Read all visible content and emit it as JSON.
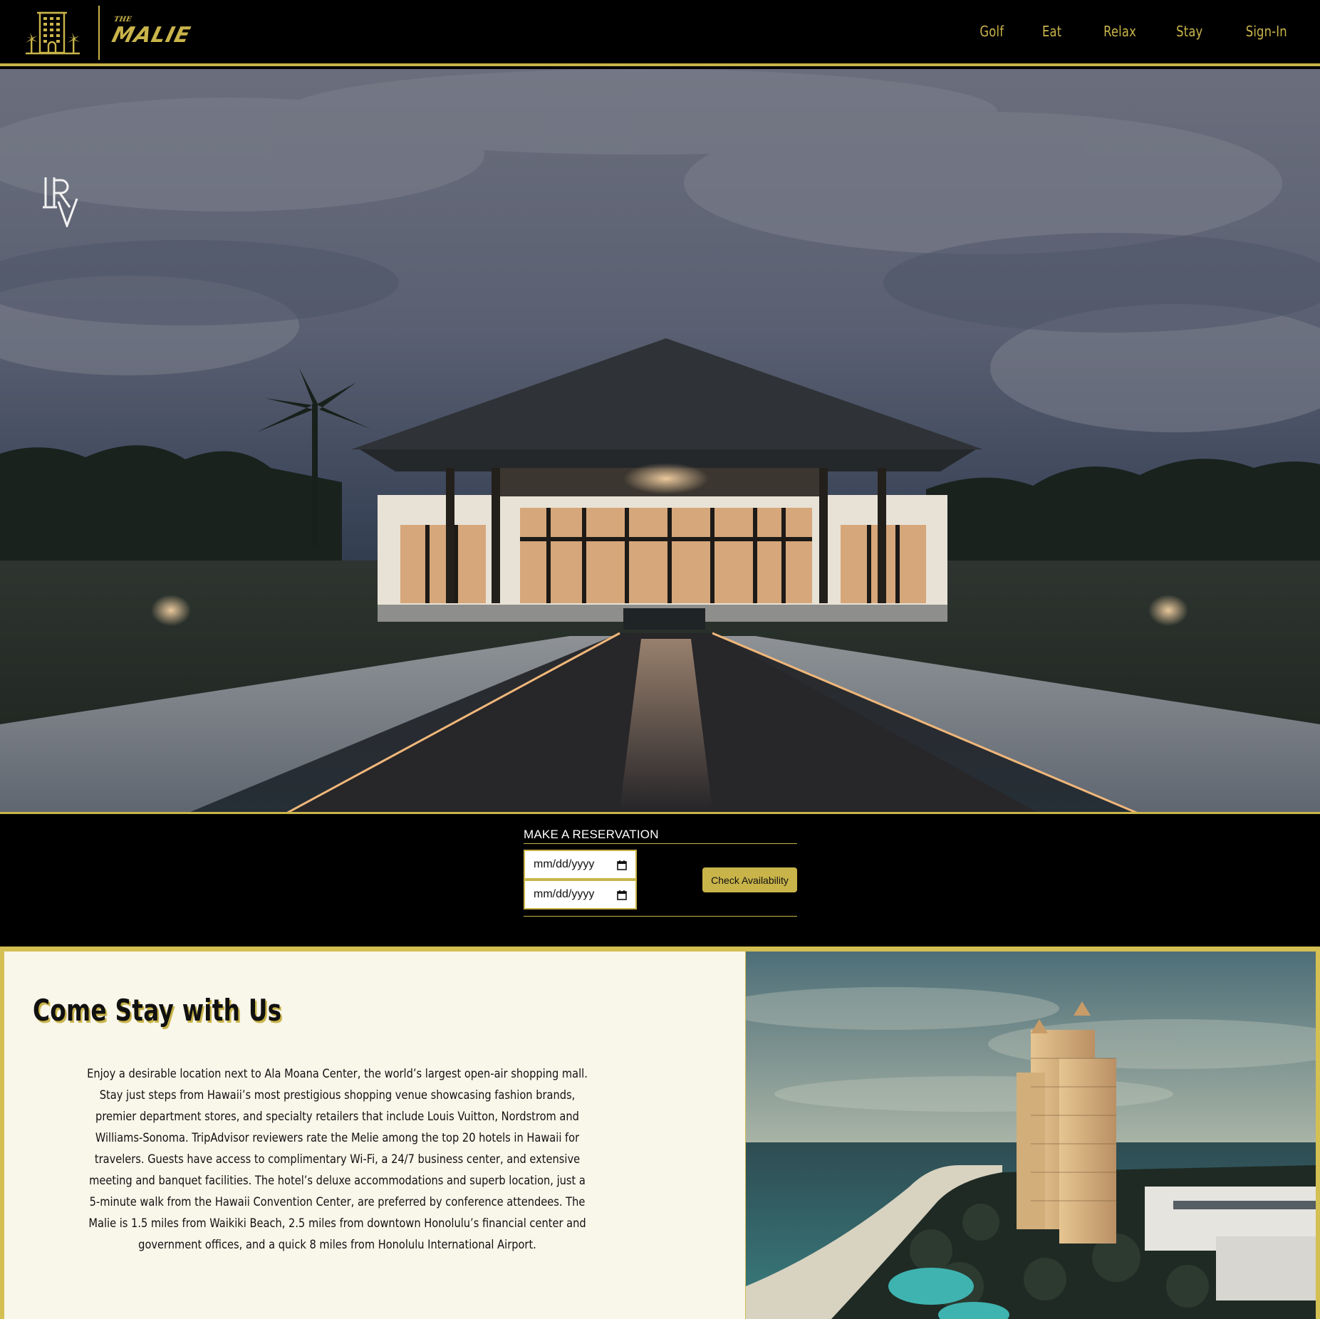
{
  "brand": {
    "small_word": "THE",
    "name": "MALIE"
  },
  "nav": {
    "items": [
      {
        "label": "Golf"
      },
      {
        "label": "Eat"
      },
      {
        "label": "Relax"
      },
      {
        "label": "Stay"
      },
      {
        "label": "Sign-In"
      }
    ]
  },
  "hero": {
    "monogram": "LRV"
  },
  "reservation": {
    "title": "MAKE A RESERVATION",
    "check_in_value": "mm/dd/yyyy",
    "check_out_value": "mm/dd/yyyy",
    "button_label": "Check Availability"
  },
  "stay": {
    "title": "Come Stay with Us",
    "body": "Enjoy a desirable location next to Ala Moana Center, the world’s largest open-air shopping mall. Stay just steps from Hawaii’s most prestigious shopping venue showcasing fashion brands, premier department stores, and specialty retailers that include Louis Vuitton, Nordstrom and Williams-Sonoma. TripAdvisor reviewers rate the Melie among the top 20 hotels in Hawaii for travelers. Guests have access to complimentary Wi-Fi, a 24/7 business center, and extensive meeting and banquet facilities. The hotel’s deluxe accommodations and superb location, just a 5-minute walk from the Hawaii Convention Center, are preferred by conference attendees. The Malie is 1.5 miles from Waikiki Beach, 2.5 miles from downtown Honolulu’s financial center and government offices, and a quick 8 miles from Honolulu International Airport."
  },
  "colors": {
    "accent_gold": "#c9b44a",
    "header_bg": "#000000",
    "panel_bg": "#f9f6ea"
  },
  "icons": [
    "hotel-building-icon",
    "calendar-icon"
  ]
}
